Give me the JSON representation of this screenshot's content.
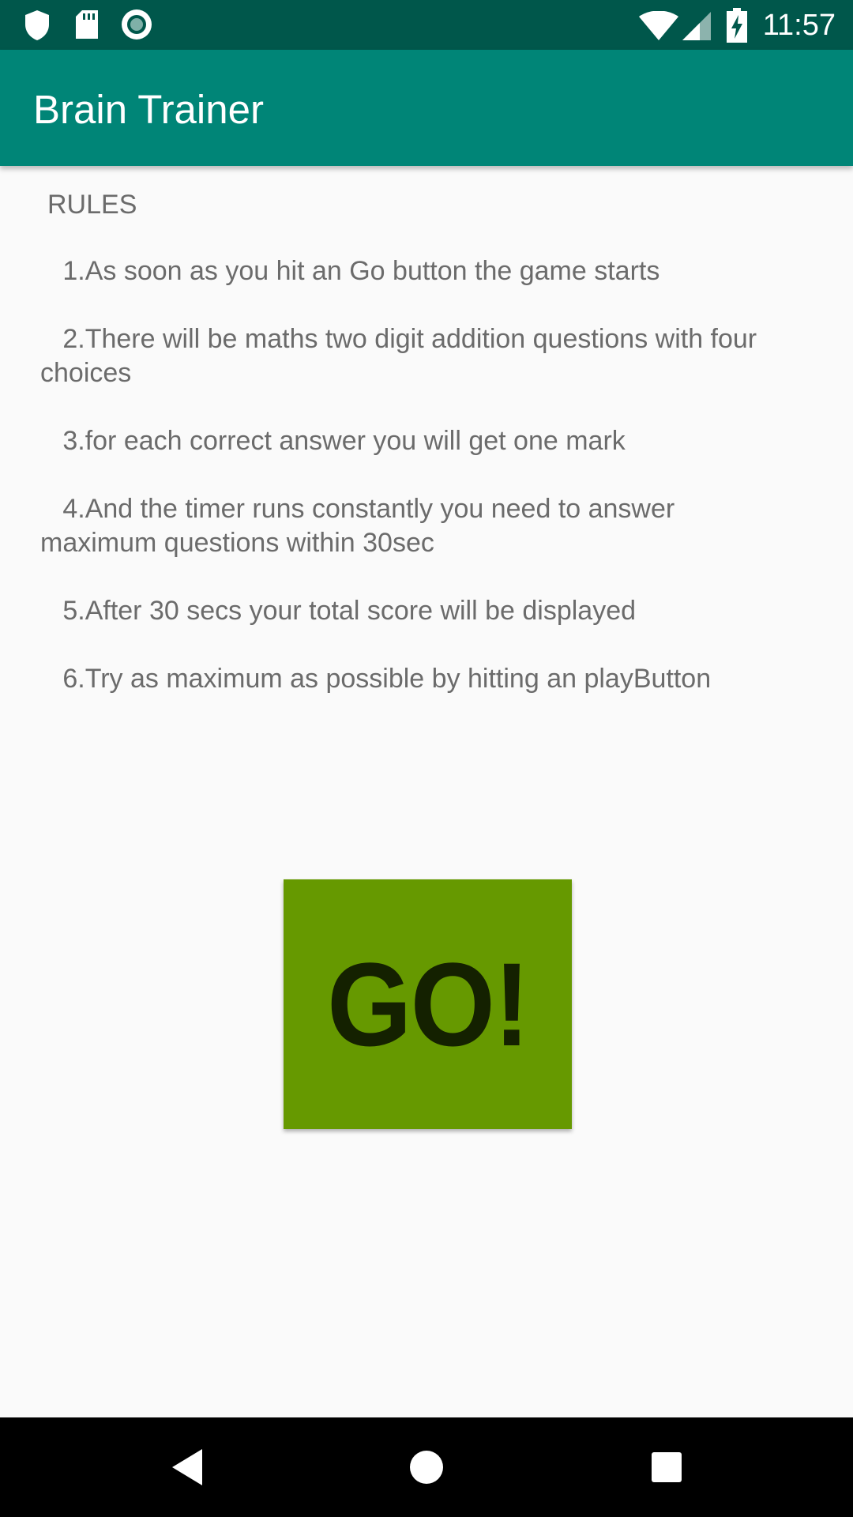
{
  "status_bar": {
    "time": "11:57",
    "left_icons": [
      "shield-icon",
      "sd-card-icon",
      "record-icon"
    ],
    "right_icons": [
      "wifi-icon",
      "cellular-signal-icon",
      "battery-charging-icon"
    ]
  },
  "app_bar": {
    "title": "Brain Trainer"
  },
  "rules": {
    "heading": "RULES",
    "items": [
      "   1.As soon as you hit an Go button the game starts",
      "   2.There will be maths two digit addition questions with four choices",
      "   3.for each correct answer you will get one mark",
      "   4.And the timer runs constantly you need to answer maximum questions within 30sec",
      "   5.After 30 secs your total score will be displayed",
      "   6.Try as maximum as possible by hitting an playButton"
    ]
  },
  "go_button": {
    "label": "GO!",
    "color": "#669900",
    "text_color": "#142100"
  },
  "colors": {
    "status_bar": "#00574b",
    "app_bar": "#008577",
    "background": "#fafafa",
    "rule_text": "#6b6b6b",
    "nav_bar": "#000000"
  },
  "nav_bar": {
    "buttons": [
      "back-icon",
      "home-icon",
      "recents-icon"
    ]
  }
}
